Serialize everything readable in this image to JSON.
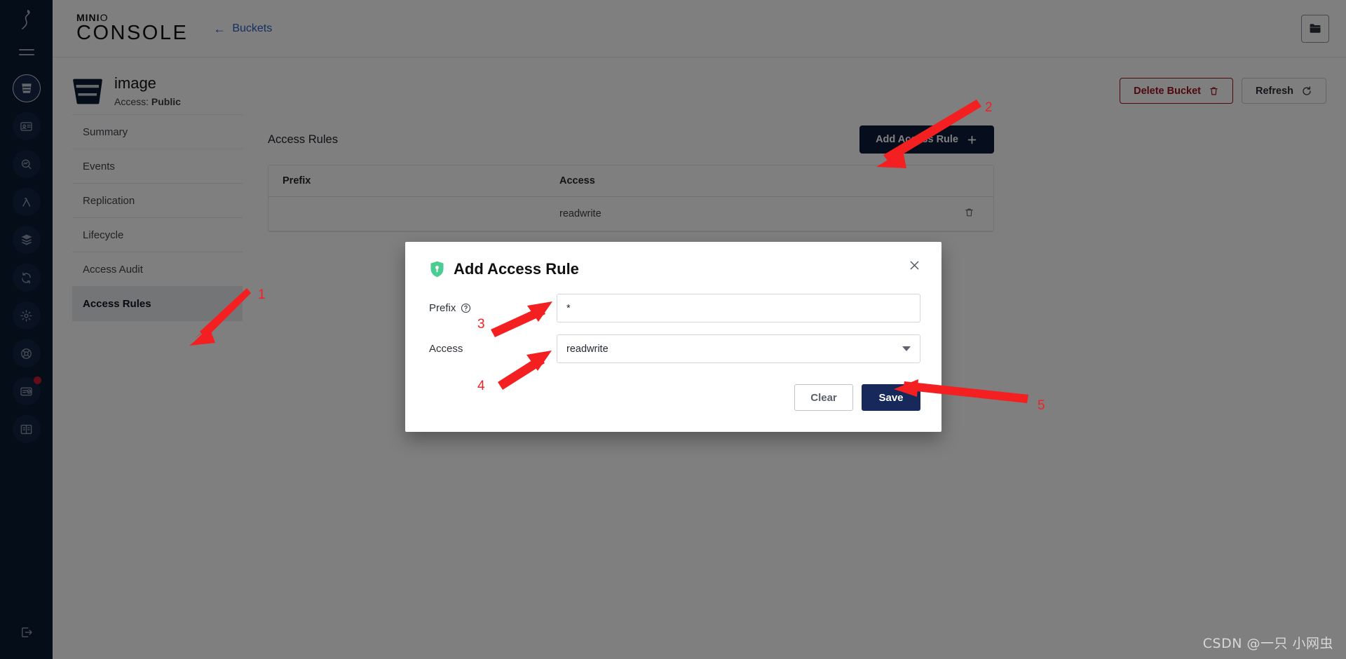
{
  "brand": {
    "mini_prefix": "MINI",
    "mini_suffix": "O",
    "console": "CONSOLE"
  },
  "topbar": {
    "back_link": "Buckets",
    "back_arrow": "←",
    "right_button_icon": "folder-icon"
  },
  "bucket": {
    "icon": "bucket-icon",
    "name": "image",
    "access_label": "Access:",
    "access_value": "Public",
    "delete_button": "Delete Bucket",
    "delete_icon": "trash-icon",
    "refresh_button": "Refresh",
    "refresh_icon": "refresh-icon"
  },
  "nav": {
    "items": [
      {
        "label": "Summary",
        "selected": false
      },
      {
        "label": "Events",
        "selected": false
      },
      {
        "label": "Replication",
        "selected": false
      },
      {
        "label": "Lifecycle",
        "selected": false
      },
      {
        "label": "Access Audit",
        "selected": false
      },
      {
        "label": "Access Rules",
        "selected": true
      }
    ]
  },
  "content": {
    "title": "Access Rules",
    "add_button": "Add Access Rule",
    "add_button_icon": "plus-icon",
    "table": {
      "columns": [
        "Prefix",
        "Access",
        ""
      ],
      "rows": [
        {
          "prefix": "",
          "access": "readwrite",
          "action_icon": "trash-icon"
        }
      ]
    }
  },
  "modal": {
    "icon": "shield-key-icon",
    "title": "Add Access Rule",
    "close_icon": "close-icon",
    "fields": [
      {
        "label": "Prefix",
        "help_icon": "help-circle-icon",
        "value": "*",
        "type": "text"
      },
      {
        "label": "Access",
        "value": "readwrite",
        "type": "select",
        "caret_icon": "chevron-down-icon"
      }
    ],
    "clear_button": "Clear",
    "save_button": "Save"
  },
  "rail": {
    "logo_icon": "minio-stork-icon",
    "menu_icon": "hamburger-icon",
    "items": [
      {
        "icon": "buckets-icon",
        "active": true,
        "badge": false
      },
      {
        "icon": "identity-icon",
        "active": false,
        "badge": false
      },
      {
        "icon": "monitoring-icon",
        "active": false,
        "badge": false
      },
      {
        "icon": "lambda-icon",
        "active": false,
        "badge": false
      },
      {
        "icon": "tiers-icon",
        "active": false,
        "badge": false
      },
      {
        "icon": "site-replication-icon",
        "active": false,
        "badge": false
      },
      {
        "icon": "settings-icon",
        "active": false,
        "badge": false
      },
      {
        "icon": "support-icon",
        "active": false,
        "badge": false
      },
      {
        "icon": "license-icon",
        "active": false,
        "badge": true
      },
      {
        "icon": "documentation-icon",
        "active": false,
        "badge": false
      }
    ],
    "logout_icon": "logout-icon"
  },
  "annotations": {
    "numbers": [
      "1",
      "2",
      "3",
      "4",
      "5"
    ],
    "color": "#f41f20"
  },
  "watermark": "CSDN @一只 小网虫",
  "colors": {
    "rail_bg": "#0b1b33",
    "primary": "#0d1c3d",
    "save": "#17285b",
    "danger": "#9c1322",
    "link": "#2760c8",
    "shield_green": "#4ccb92",
    "annotation_red": "#f41f20"
  }
}
